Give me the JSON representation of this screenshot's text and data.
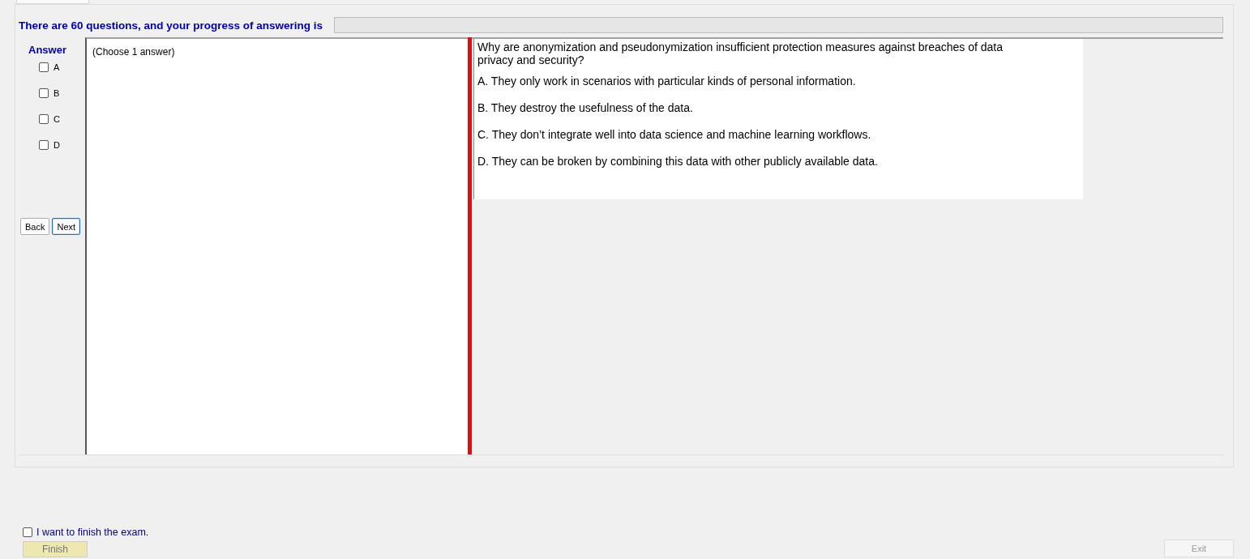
{
  "header": {
    "text": "There are 60 questions, and your progress of answering is",
    "progress": {
      "level": 0
    }
  },
  "answer_panel": {
    "title": "Answer",
    "options": [
      {
        "label": "A",
        "checked": false
      },
      {
        "label": "B",
        "checked": false
      },
      {
        "label": "C",
        "checked": false
      },
      {
        "label": "D",
        "checked": false
      }
    ],
    "buttons": [
      {
        "label": "Back",
        "focused": false
      },
      {
        "label": "Next",
        "focused": true
      }
    ]
  },
  "instruction": "(Choose 1 answer)",
  "question": {
    "text": "Why are anonymization and pseudonymization insufficient protection measures against breaches of data privacy and security?",
    "choices": [
      "A.  They only work in scenarios with particular kinds of personal information.",
      "B.  They destroy the usefulness of the data.",
      "C.  They don’t integrate well into data science and machine learning workflows.",
      "D.  They can be broken by combining this data with other publicly available data."
    ]
  },
  "finish": {
    "label": "I want to finish the exam.",
    "checked": false,
    "button": {
      "label": "Finish",
      "disabled": true
    }
  },
  "exit_button": {
    "label": "Exit",
    "disabled": true
  }
}
